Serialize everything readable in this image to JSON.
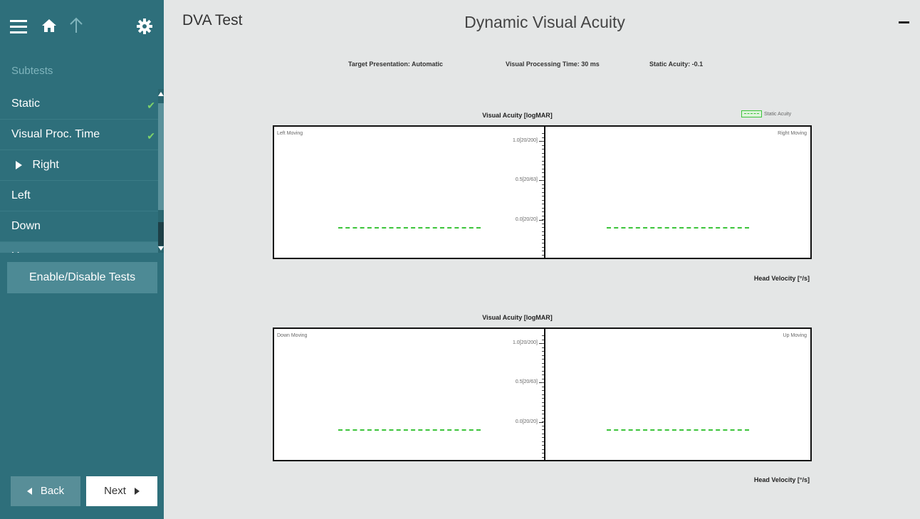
{
  "header": {
    "left_title": "DVA Test",
    "title": "Dynamic Visual Acuity"
  },
  "sidebar": {
    "section_label": "Subtests",
    "items": [
      {
        "label": "Static",
        "checked": true
      },
      {
        "label": "Visual Proc. Time",
        "checked": true
      },
      {
        "label": "Right",
        "selected": true
      },
      {
        "label": "Left"
      },
      {
        "label": "Down"
      },
      {
        "label": "Up"
      }
    ],
    "enable_button": "Enable/Disable Tests",
    "back_button": "Back",
    "next_button": "Next"
  },
  "info": {
    "target_presentation": "Target Presentation: Automatic",
    "visual_processing_time": "Visual Processing Time: 30 ms",
    "static_acuity": "Static Acuity: -0.1"
  },
  "legend": {
    "label": "Static Acuity",
    "color": "#3cc43a"
  },
  "charts": [
    {
      "title": "Visual Acuity [logMAR]",
      "left_label": "Left Moving",
      "right_label": "Right Moving",
      "xlabel": "Head Velocity [°/s]",
      "yticks": [
        "1.0[20/200]",
        "0.5[20/63]",
        "0.0[20/20]"
      ]
    },
    {
      "title": "Visual Acuity [logMAR]",
      "left_label": "Down Moving",
      "right_label": "Up Moving",
      "xlabel": "Head Velocity [°/s]",
      "yticks": [
        "1.0[20/200]",
        "0.5[20/63]",
        "0.0[20/20]"
      ]
    }
  ],
  "chart_data": [
    {
      "type": "line",
      "title": "Visual Acuity [logMAR]",
      "xlabel": "Head Velocity [°/s]",
      "ylabel": "Visual Acuity [logMAR]",
      "yticks": [
        1.0,
        0.5,
        0.0
      ],
      "panels": [
        "Left Moving",
        "Right Moving"
      ],
      "series": [
        {
          "name": "Static Acuity",
          "values": [
            -0.1
          ]
        }
      ]
    },
    {
      "type": "line",
      "title": "Visual Acuity [logMAR]",
      "xlabel": "Head Velocity [°/s]",
      "ylabel": "Visual Acuity [logMAR]",
      "yticks": [
        1.0,
        0.5,
        0.0
      ],
      "panels": [
        "Down Moving",
        "Up Moving"
      ],
      "series": [
        {
          "name": "Static Acuity",
          "values": [
            -0.1
          ]
        }
      ]
    }
  ]
}
